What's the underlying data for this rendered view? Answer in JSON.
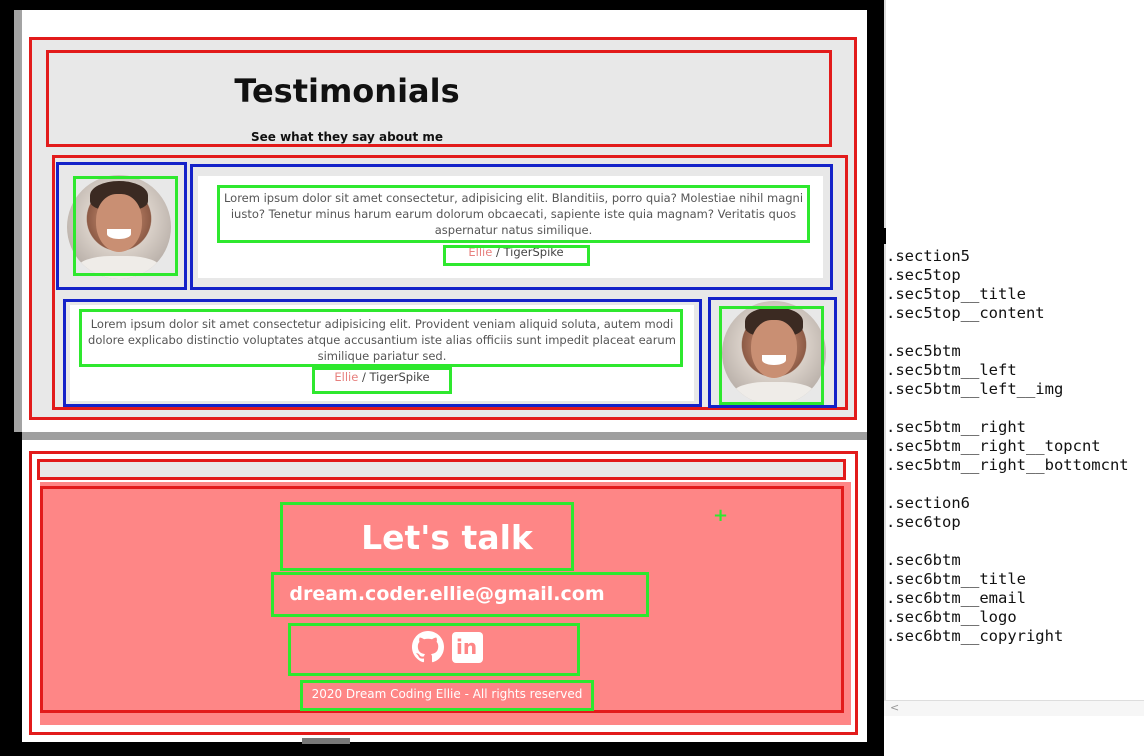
{
  "section5": {
    "title": "Testimonials",
    "subtitle": "See what they say about me",
    "testimonials": [
      {
        "quote": "Lorem ipsum dolor sit amet consectetur, adipisicing elit. Blanditiis, porro quia? Molestiae nihil magni iusto? Tenetur minus harum earum dolorum obcaecati, sapiente iste quia magnam? Veritatis quos aspernatur natus similique.",
        "name": "Ellie",
        "company": " / TigerSpike"
      },
      {
        "quote": "Lorem ipsum dolor sit amet consectetur adipisicing elit. Provident veniam aliquid soluta, autem modi dolore explicabo distinctio voluptates atque accusantium iste alias officiis sunt impedit placeat earum similique pariatur sed.",
        "name": "Ellie",
        "company": " / TigerSpike"
      }
    ]
  },
  "section6": {
    "title": "Let's talk",
    "email": "dream.coder.ellie@gmail.com",
    "copyright": "2020 Dream Coding Ellie - All rights reserved",
    "icons": [
      "github-icon",
      "linkedin-icon"
    ],
    "linkedin_text": "in"
  },
  "annotation": {
    "plus_mark": "+"
  },
  "class_list": [
    ".section5",
    ".sec5top",
    ".sec5top__title",
    ".sec5top__content",
    "",
    ".sec5btm",
    ".sec5btm__left",
    ".sec5btm__left__img",
    "",
    ".sec5btm__right",
    ".sec5btm__right__topcnt",
    ".sec5btm__right__bottomcnt",
    "",
    ".section6",
    ".sec6top",
    "",
    ".sec6btm",
    ".sec6btm__title",
    ".sec6btm__email",
    ".sec6btm__logo",
    ".sec6btm__copyright"
  ],
  "panel": {
    "scroll_arrow": "<"
  },
  "colors": {
    "accent_red_outline": "#e21b1b",
    "blue_outline": "#1422c8",
    "green_outline": "#2ee82e",
    "sec6_bg": "#fe8686",
    "name_highlight": "#e7807e"
  }
}
